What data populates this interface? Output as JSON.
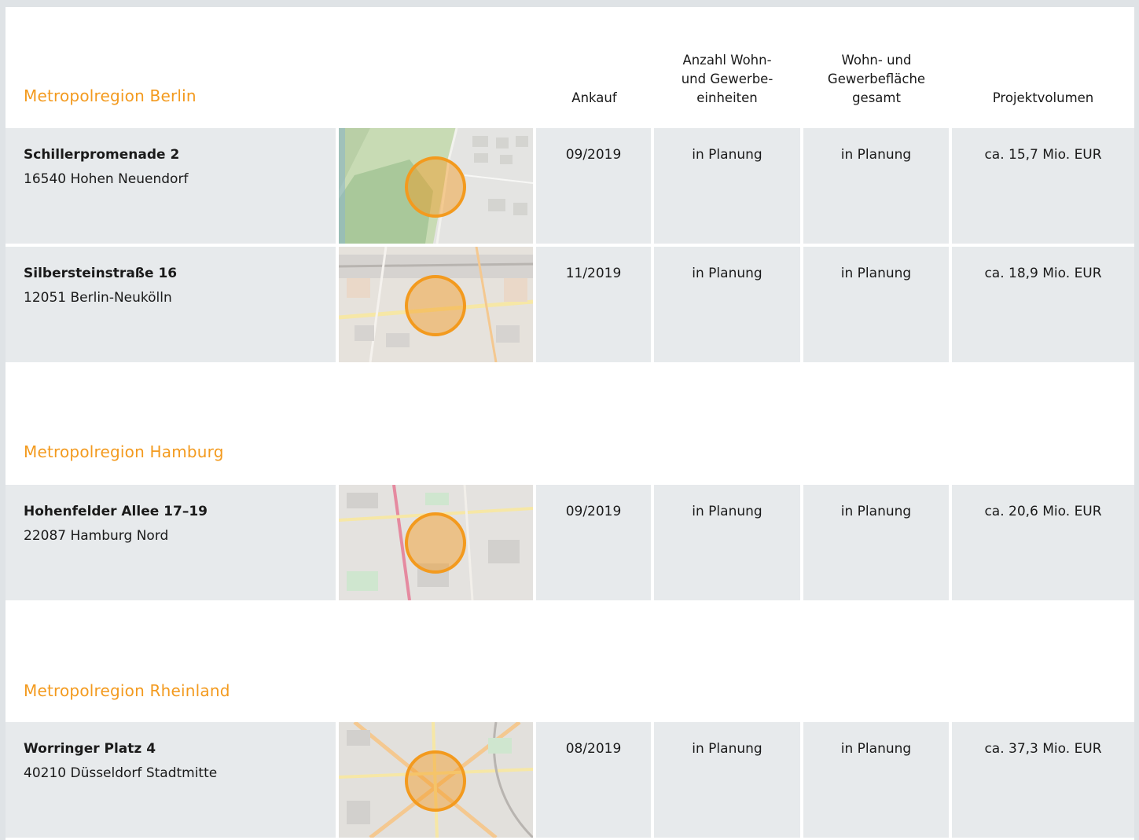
{
  "columns": {
    "ankauf": "Ankauf",
    "einheiten": [
      "Anzahl Wohn-",
      "und Gewerbe-",
      "einheiten"
    ],
    "flaeche": [
      "Wohn- und",
      "Gewerbefläche",
      "gesamt"
    ],
    "volumen": "Projektvolumen"
  },
  "regions": [
    {
      "title": "Metropolregion Berlin",
      "projects": [
        {
          "street": "Schillerpromenade 2",
          "city": "16540 Hohen Neuendorf",
          "ankauf": "09/2019",
          "einheiten": "in Planung",
          "flaeche": "in Planung",
          "volumen": "ca. 15,7 Mio. EUR",
          "map_icon": "map-marker-circle"
        },
        {
          "street": "Silbersteinstraße 16",
          "city": "12051 Berlin-Neukölln",
          "ankauf": "11/2019",
          "einheiten": "in Planung",
          "flaeche": "in Planung",
          "volumen": "ca. 18,9 Mio. EUR",
          "map_icon": "map-marker-circle"
        }
      ]
    },
    {
      "title": "Metropolregion Hamburg",
      "projects": [
        {
          "street": "Hohenfelder Allee 17–19",
          "city": "22087 Hamburg Nord",
          "ankauf": "09/2019",
          "einheiten": "in Planung",
          "flaeche": "in Planung",
          "volumen": "ca. 20,6 Mio. EUR",
          "map_icon": "map-marker-circle"
        }
      ]
    },
    {
      "title": "Metropolregion Rheinland",
      "projects": [
        {
          "street": "Worringer Platz 4",
          "city": "40210 Düsseldorf Stadtmitte",
          "ankauf": "08/2019",
          "einheiten": "in Planung",
          "flaeche": "in Planung",
          "volumen": "ca. 37,3 Mio. EUR",
          "map_icon": "map-marker-circle"
        }
      ]
    }
  ],
  "colors": {
    "accent": "#f39a1e",
    "cell_bg": "#e7eaec",
    "page_bg": "#dfe3e6"
  }
}
